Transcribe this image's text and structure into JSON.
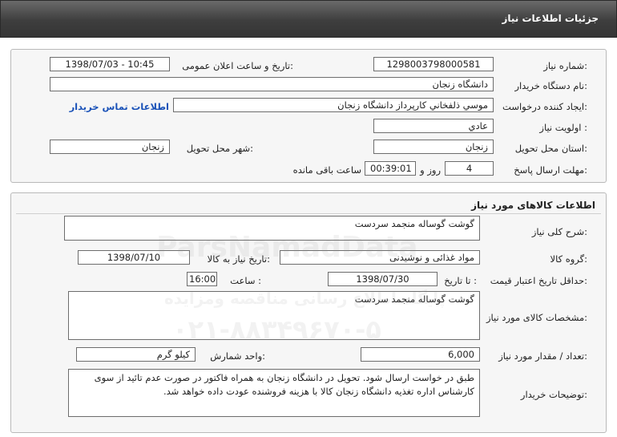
{
  "page_title": "جزئیات اطلاعات نیاز",
  "top": {
    "need_number_label": "شماره نیاز:",
    "need_number": "1298003798000581",
    "announce_label": "تاریخ و ساعت اعلان عمومی:",
    "announce_value": "1398/07/03 - 10:45",
    "buyer_label": "نام دستگاه خریدار:",
    "buyer_value": "دانشگاه زنجان",
    "creator_label": "ایجاد کننده درخواست:",
    "creator_value": "موسي ذلفخاني کارپرداز دانشگاه زنجان",
    "contact_link": "اطلاعات تماس خریدار",
    "priority_label": "اولویت نیاز :",
    "priority_value": "عادي",
    "province_label": "استان محل تحویل:",
    "province_value": "زنجان",
    "city_label": "شهر محل تحویل:",
    "city_value": "زنجان",
    "deadline_label": "مهلت ارسال پاسخ:",
    "deadline_days": "4",
    "days_and_label": "روز و",
    "deadline_time": "00:39:01",
    "remaining_label": "ساعت باقی مانده"
  },
  "goods": {
    "section_title": "اطلاعات کالاهای مورد نیاز",
    "summary_label": "شرح کلی نیاز:",
    "summary_value": "گوشت گوساله منجمد سردست",
    "group_label": "گروه کالا:",
    "group_value": "مواد غذائی و نوشیدنی",
    "need_date_label": "تاریخ نیاز به کالا:",
    "need_date_value": "1398/07/10",
    "validity_label": "حداقل تاریخ اعتبار قیمت:",
    "until_label": "تا تاریخ :",
    "validity_date": "1398/07/30",
    "time_label": "ساعت :",
    "validity_time": "16:00",
    "specs_label": "مشخصات کالای مورد نیاز:",
    "specs_value": "گوشت گوساله منجمد سردست",
    "qty_label": "تعداد / مقدار مورد نیاز:",
    "qty_value": "6,000",
    "unit_label": "واحد شمارش:",
    "unit_value": "کیلو گرم",
    "notes_label": "توضیحات خریدار:",
    "notes_value": "طبق در خواست ارسال شود. تحویل در دانشگاه زنجان به همراه فاکتور در صورت عدم تائید از سوی کارشناس اداره تغذیه دانشگاه زنجان کالا با هزینه فروشنده عودت داده خواهد شد."
  },
  "watermark": {
    "line1": "ParsNamadData",
    "line2": "پایگاه اطلاع رسانی مناقصه ومزایده",
    "line3": "۰۲۱-۸۸۳۴۹۶۷۰-۵"
  }
}
